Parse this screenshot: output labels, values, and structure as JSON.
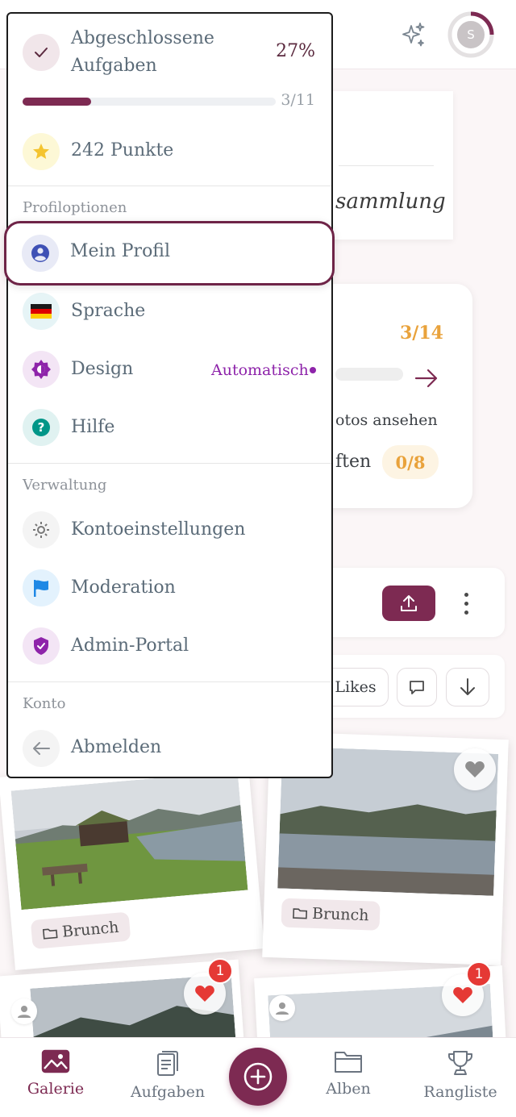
{
  "header": {
    "sparkle_icon": "sparkles-icon",
    "avatar_initial": "S"
  },
  "background": {
    "card1_text": "sammlung",
    "card2": {
      "count": "3/14",
      "line1": "otos ansehen",
      "line2": "ften",
      "pill": "0/8"
    },
    "likes_label": "Likes"
  },
  "gallery": {
    "photos": [
      {
        "album": "Brunch",
        "likes": ""
      },
      {
        "album": "Brunch",
        "likes": ""
      },
      {
        "album": "",
        "likes": "1"
      },
      {
        "album": "",
        "likes": "1"
      }
    ]
  },
  "menu": {
    "progress": {
      "label": "Abgeschlossene Aufgaben",
      "percent_text": "27%",
      "count_text": "3/11",
      "fraction": 0.27
    },
    "points": "242 Punkte",
    "section_profile": "Profiloptionen",
    "items_profile": [
      {
        "label": "Mein Profil",
        "icon": "user-icon"
      },
      {
        "label": "Sprache",
        "icon": "german-flag-icon"
      },
      {
        "label": "Design",
        "icon": "theme-icon",
        "value": "Automatisch"
      },
      {
        "label": "Hilfe",
        "icon": "help-icon"
      }
    ],
    "section_admin": "Verwaltung",
    "items_admin": [
      {
        "label": "Kontoeinstellungen",
        "icon": "gear-icon"
      },
      {
        "label": "Moderation",
        "icon": "flag-icon"
      },
      {
        "label": "Admin-Portal",
        "icon": "shield-check-icon"
      }
    ],
    "section_account": "Konto",
    "logout": "Abmelden"
  },
  "nav": {
    "items": [
      {
        "label": "Galerie",
        "icon": "image-icon"
      },
      {
        "label": "Aufgaben",
        "icon": "clipboard-icon"
      },
      {
        "label": "Alben",
        "icon": "folder-icon"
      },
      {
        "label": "Rangliste",
        "icon": "trophy-icon"
      }
    ],
    "fab_icon": "plus-icon"
  },
  "colors": {
    "accent": "#7d2a52",
    "gold": "#e9a23b",
    "purple": "#8e24aa",
    "badge": "#e53935"
  }
}
